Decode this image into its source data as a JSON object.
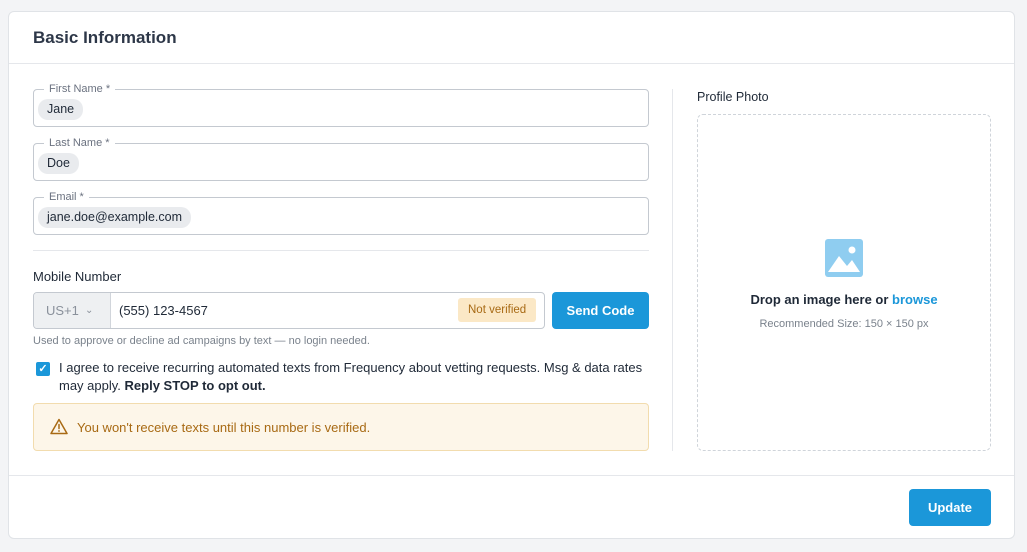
{
  "header": {
    "title": "Basic Information"
  },
  "form": {
    "first_name": {
      "label": "First Name *",
      "value": "Jane"
    },
    "last_name": {
      "label": "Last Name *",
      "value": "Doe"
    },
    "email": {
      "label": "Email *",
      "value": "jane.doe@example.com"
    },
    "mobile": {
      "label": "Mobile Number",
      "country_code": "US+1",
      "value": "(555) 123-4567",
      "status_badge": "Not verified",
      "send_code_label": "Send Code",
      "helper_text": "Used to approve or decline ad campaigns by text — no login needed."
    },
    "consent": {
      "checked": true,
      "text": "I agree to receive recurring automated texts from Frequency about vetting requests. Msg & data rates may apply.",
      "bold_text": "Reply STOP to opt out."
    },
    "alert": {
      "text": "You won't receive texts until this number is verified.",
      "icon": "warning-triangle-icon"
    }
  },
  "photo": {
    "label": "Profile Photo",
    "icon": "image-icon",
    "drop_text": "Drop an image here or",
    "browse_label": "browse",
    "recommended": "Recommended Size: 150 × 150 px"
  },
  "footer": {
    "update_label": "Update"
  },
  "colors": {
    "accent": "#1b97d9",
    "warning_text": "#a86a14",
    "warning_bg": "#fdf6e9",
    "badge_bg": "#fbe8c6"
  }
}
